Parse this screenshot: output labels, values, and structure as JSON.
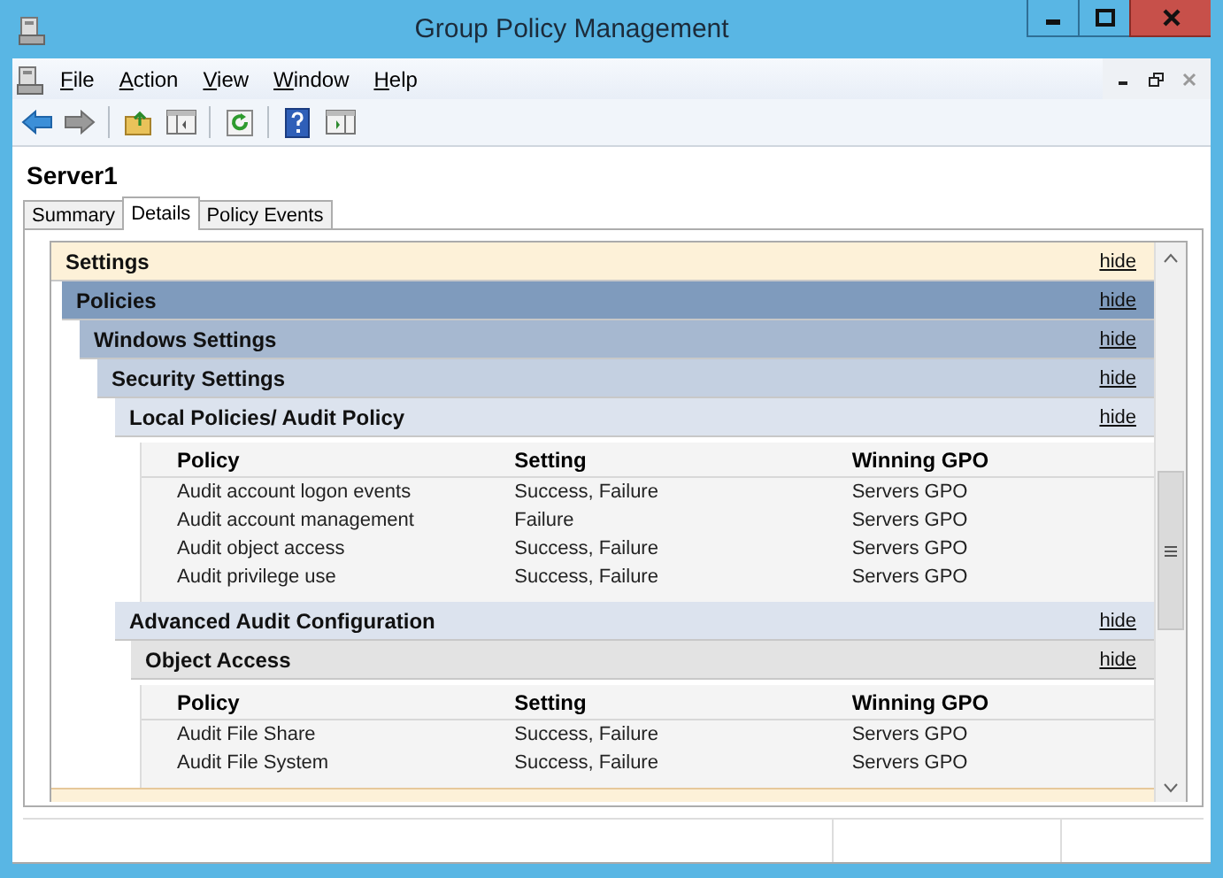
{
  "window": {
    "title": "Group Policy Management"
  },
  "menu": [
    {
      "label": "File"
    },
    {
      "label": "Action"
    },
    {
      "label": "View"
    },
    {
      "label": "Window"
    },
    {
      "label": "Help"
    }
  ],
  "heading": "Server1",
  "tabs": [
    {
      "label": "Summary",
      "selected": false
    },
    {
      "label": "Details",
      "selected": true
    },
    {
      "label": "Policy Events",
      "selected": false
    }
  ],
  "report": {
    "sections": [
      {
        "title": "Settings",
        "action": "hide",
        "children": [
          {
            "title": "Policies",
            "action": "hide",
            "children": [
              {
                "title": "Windows Settings",
                "action": "hide",
                "children": [
                  {
                    "title": "Security Settings",
                    "action": "hide",
                    "children": [
                      {
                        "title": "Local Policies/ Audit Policy",
                        "action": "hide",
                        "table": {
                          "columns": [
                            "Policy",
                            "Setting",
                            "Winning GPO"
                          ],
                          "rows": [
                            [
                              "Audit account logon events",
                              "Success, Failure",
                              "Servers GPO"
                            ],
                            [
                              "Audit account management",
                              "Failure",
                              "Servers GPO"
                            ],
                            [
                              "Audit object access",
                              "Success, Failure",
                              "Servers GPO"
                            ],
                            [
                              "Audit privilege use",
                              "Success, Failure",
                              "Servers GPO"
                            ]
                          ]
                        }
                      },
                      {
                        "title": "Advanced Audit Configuration",
                        "action": "hide",
                        "children": [
                          {
                            "title": "Object Access",
                            "action": "hide",
                            "table": {
                              "columns": [
                                "Policy",
                                "Setting",
                                "Winning GPO"
                              ],
                              "rows": [
                                [
                                  "Audit File Share",
                                  "Success, Failure",
                                  "Servers GPO"
                                ],
                                [
                                  "Audit File System",
                                  "Success, Failure",
                                  "Servers GPO"
                                ]
                              ]
                            }
                          }
                        ]
                      }
                    ]
                  }
                ]
              }
            ]
          }
        ]
      }
    ]
  }
}
